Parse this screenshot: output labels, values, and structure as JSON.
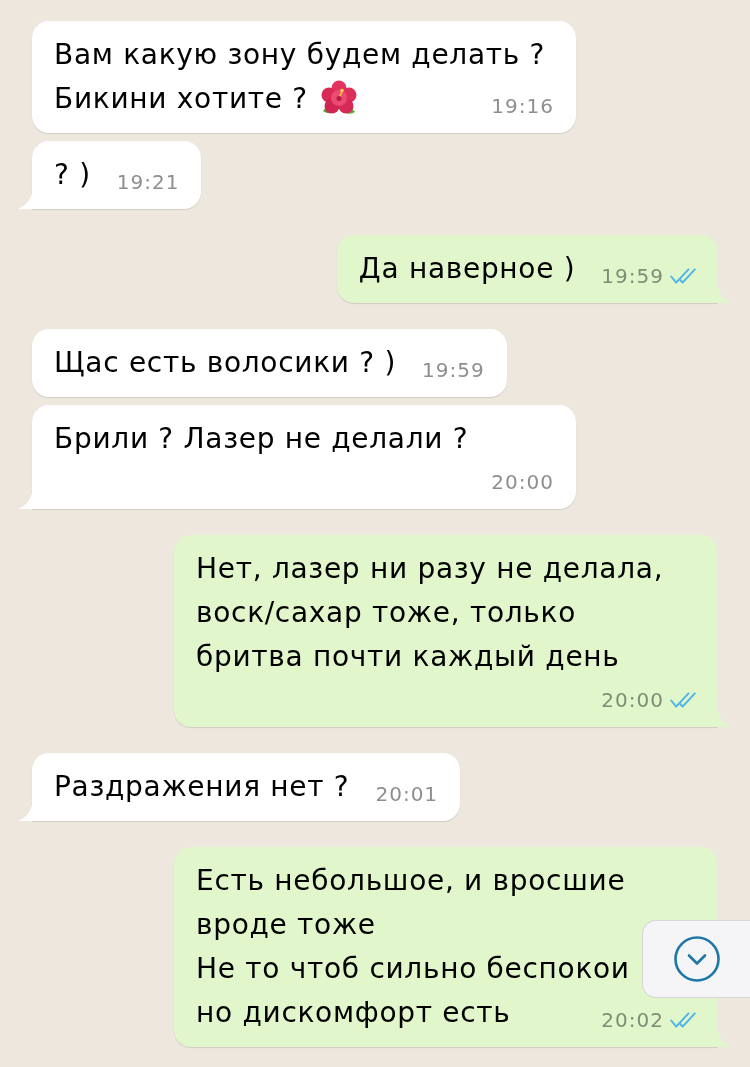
{
  "messages": [
    {
      "kind": "incoming",
      "lines": [
        "Вам какую зону будем делать ?",
        "Бикини хотите ?"
      ],
      "emoji": true,
      "time": "19:16",
      "tail": false
    },
    {
      "kind": "incoming",
      "lines": [
        "? )"
      ],
      "time": "19:21",
      "tail": true
    },
    {
      "kind": "outgoing",
      "lines": [
        "Да наверное )"
      ],
      "time": "19:59",
      "read": true,
      "tail": true
    },
    {
      "kind": "incoming",
      "lines": [
        "Щас есть волосики ? )"
      ],
      "time": "19:59",
      "tail": false
    },
    {
      "kind": "incoming",
      "lines": [
        "Брили ? Лазер не делали ?"
      ],
      "time": "20:00",
      "tail": true
    },
    {
      "kind": "outgoing",
      "lines": [
        "Нет, лазер ни разу не делала,",
        "воск/сахар тоже, только",
        "бритва почти каждый день"
      ],
      "time": "20:00",
      "read": true,
      "tail": true
    },
    {
      "kind": "incoming",
      "lines": [
        "Раздражения нет ?"
      ],
      "time": "20:01",
      "tail": true
    },
    {
      "kind": "outgoing",
      "lines": [
        "Есть небольшое, и вросшие",
        "вроде тоже",
        "Не то чтоб сильно беспокои",
        "но дискомфорт есть"
      ],
      "time": "20:02",
      "read": true,
      "tail": true
    }
  ]
}
